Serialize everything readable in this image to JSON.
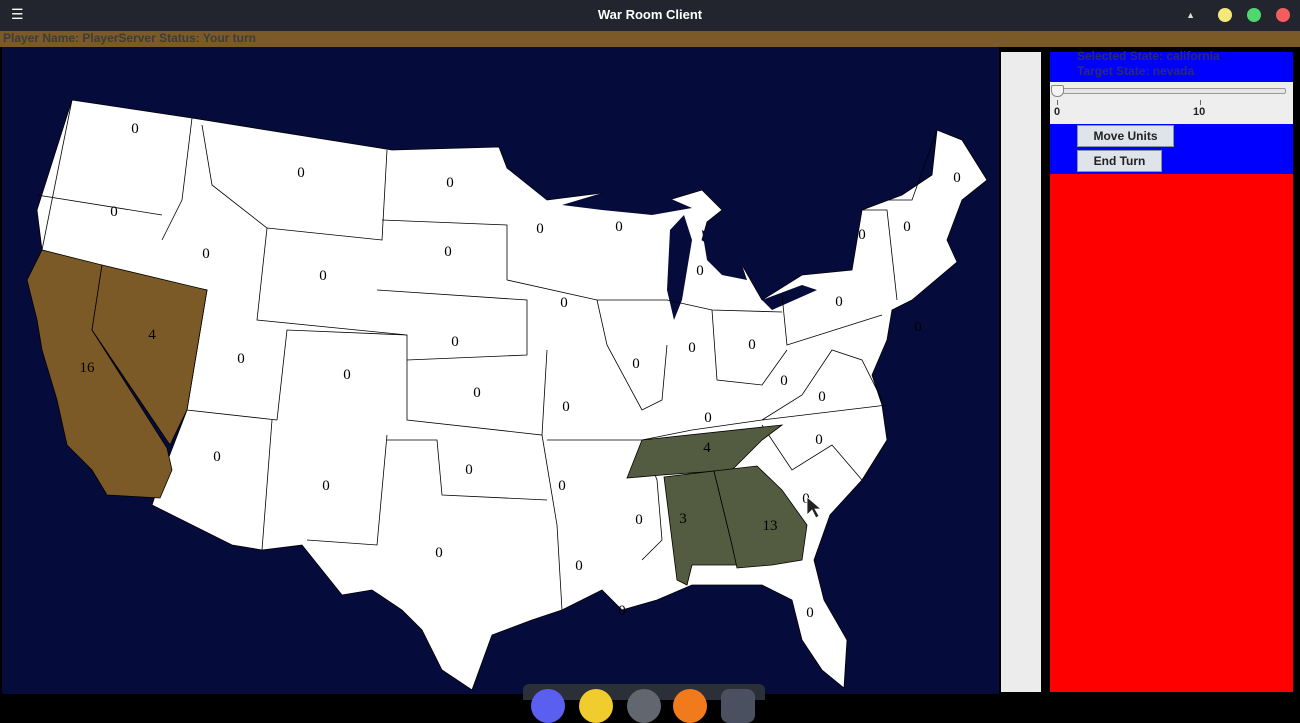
{
  "window": {
    "title": "War Room Client",
    "menu_icon": "hamburger-menu-icon",
    "controls": [
      {
        "name": "minimize",
        "color": "#f4e87a"
      },
      {
        "name": "maximize",
        "color": "#4fd86c"
      },
      {
        "name": "close",
        "color": "#f35d5d"
      }
    ]
  },
  "status_bar": {
    "text": "Player Name: PlayerServer Status: Your turn",
    "color": "#7c5a27"
  },
  "map": {
    "background": "#050c3c",
    "colors": {
      "player_owned": "#7c5a27",
      "enemy_owned": "#535c40",
      "neutral": "#ffffff"
    },
    "state_labels": [
      "0",
      "0",
      "0",
      "0",
      "0",
      "0",
      "0",
      "0",
      "0",
      "0",
      "0",
      "0",
      "0",
      "0",
      "0",
      "0",
      "0",
      "0",
      "0",
      "0",
      "0",
      "0",
      "0",
      "0",
      "0",
      "0",
      "0",
      "0",
      "0",
      "0",
      "0",
      "0",
      "0",
      "0",
      "0",
      "0",
      "0",
      "0",
      "0",
      "0",
      "0",
      "0",
      "4",
      "16",
      "4",
      "3",
      "13"
    ]
  },
  "side_panel": {
    "selected_state": "Selected State: california",
    "target_state": "Target State: nevada",
    "slider": {
      "min_label": "0",
      "mid_label": "10",
      "value": 0
    },
    "move_units_label": "Move Units",
    "end_turn_label": "End Turn"
  },
  "dock": {
    "icons": [
      "blue-app-icon",
      "yellow-app-icon",
      "gray-app-icon",
      "firefox-icon",
      "terminal-icon"
    ]
  }
}
